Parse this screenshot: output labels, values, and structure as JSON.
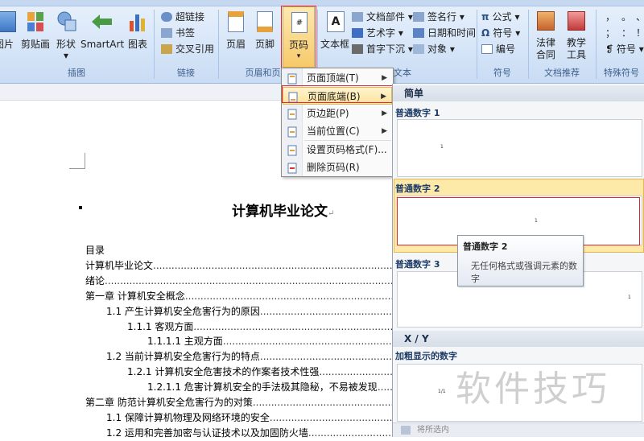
{
  "ribbon": {
    "groups": {
      "illustrations": "插图",
      "links": "链接",
      "header_footer": "页眉和页脚",
      "text": "文本",
      "symbols": "符号",
      "recommend": "文档推荐",
      "special": "特殊符号"
    },
    "buttons": {
      "picture": "图片",
      "clipart": "剪贴画",
      "shapes": "形状",
      "smartart": "SmartArt",
      "chart": "图表",
      "header": "页眉",
      "footer": "页脚",
      "page_number": "页码",
      "textbox": "文本框",
      "law_line1": "法律",
      "law_line2": "合同",
      "teach_line1": "教学",
      "teach_line2": "工具"
    },
    "links": [
      "超链接",
      "书签",
      "交叉引用"
    ],
    "text_small": [
      "文档部件",
      "艺术字",
      "首字下沉"
    ],
    "text_small2": [
      "签名行",
      "日期和时间",
      "对象"
    ],
    "symbols_small": [
      "公式",
      "符号",
      "编号"
    ],
    "special_small": [
      "，",
      "。",
      "、",
      "；",
      "：",
      "！",
      "符号"
    ]
  },
  "menu": {
    "items": [
      {
        "label": "页面顶端(T)",
        "icon": "page-top-icon",
        "submenu": true
      },
      {
        "label": "页面底端(B)",
        "icon": "page-bottom-icon",
        "submenu": true
      },
      {
        "label": "页边距(P)",
        "icon": "page-margin-icon",
        "submenu": true
      },
      {
        "label": "当前位置(C)",
        "icon": "current-position-icon",
        "submenu": true
      },
      {
        "label": "设置页码格式(F)...",
        "icon": "format-page-number-icon",
        "submenu": false
      },
      {
        "label": "删除页码(R)",
        "icon": "remove-page-number-icon",
        "submenu": false
      }
    ],
    "highlighted_index": 1
  },
  "gallery": {
    "section_simple": "简单",
    "item1": "普通数字 1",
    "item2": "普通数字 2",
    "item3": "普通数字 3",
    "section_xy": "X / Y",
    "item4": "加粗显示的数字",
    "preview_num": "1",
    "preview_xy": "1/1",
    "footer_text": "将所选内"
  },
  "tooltip": {
    "title": "普通数字 2",
    "desc": "无任何格式或强调元素的数字"
  },
  "document": {
    "title": "计算机毕业论文",
    "toc": [
      {
        "text": "目录",
        "level": 0,
        "dots": false
      },
      {
        "text": "计算机毕业论文",
        "level": 0,
        "dots": true
      },
      {
        "text": "绪论",
        "level": 0,
        "dots": true
      },
      {
        "text": "第一章  计算机安全概念",
        "level": 0,
        "dots": true
      },
      {
        "text": "1.1  产生计算机安全危害行为的原因",
        "level": 1,
        "dots": true
      },
      {
        "text": "1.1.1  客观方面",
        "level": 2,
        "dots": true
      },
      {
        "text": "1.1.1.1  主观方面",
        "level": 3,
        "dots": true
      },
      {
        "text": "1.2  当前计算机安全危害行为的特点",
        "level": 1,
        "dots": true
      },
      {
        "text": "1.2.1  计算机安全危害技术的作案者技术性强",
        "level": 2,
        "dots": true
      },
      {
        "text": "1.2.1.1  危害计算机安全的手法极其隐秘，不易被发现",
        "level": 3,
        "dots": true
      },
      {
        "text": "第二章  防范计算机安全危害行为的对策",
        "level": 0,
        "dots": true
      },
      {
        "text": "1.1  保障计算机物理及网络环境的安全",
        "level": 1,
        "dots": true
      },
      {
        "text": "1.2  运用和完善加密与认证技术以及加固防火墙",
        "level": 1,
        "dots": true
      }
    ]
  },
  "watermark": "软件技巧",
  "colors": {
    "ribbon_bg": "#d7e6f8",
    "highlight": "#fde39b",
    "red_annotation": "#e0263c"
  }
}
